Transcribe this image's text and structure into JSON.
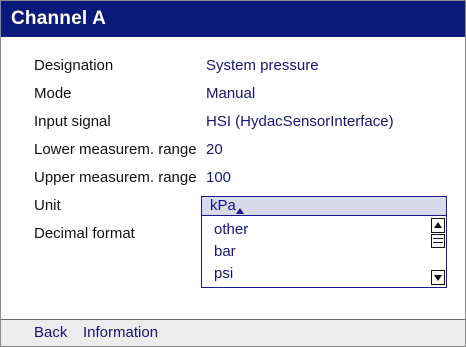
{
  "window": {
    "title": "Channel A"
  },
  "fields": [
    {
      "label": "Designation",
      "value": "System pressure"
    },
    {
      "label": "Mode",
      "value": "Manual"
    },
    {
      "label": "Input signal",
      "value": "HSI (HydacSensorInterface)"
    },
    {
      "label": "Lower measurem. range",
      "value": "20"
    },
    {
      "label": "Upper measurem. range",
      "value": "100"
    },
    {
      "label": "Unit",
      "value": ""
    },
    {
      "label": "Decimal format",
      "value": ""
    }
  ],
  "unit_dropdown": {
    "selected": "kPa",
    "options": [
      "other",
      "bar",
      "psi"
    ]
  },
  "footer": {
    "back_label": "Back",
    "info_label": "Information"
  },
  "colors": {
    "title_bar": "#0b1a7a",
    "value_text": "#15157a",
    "select_bg": "#d9d9ec"
  }
}
